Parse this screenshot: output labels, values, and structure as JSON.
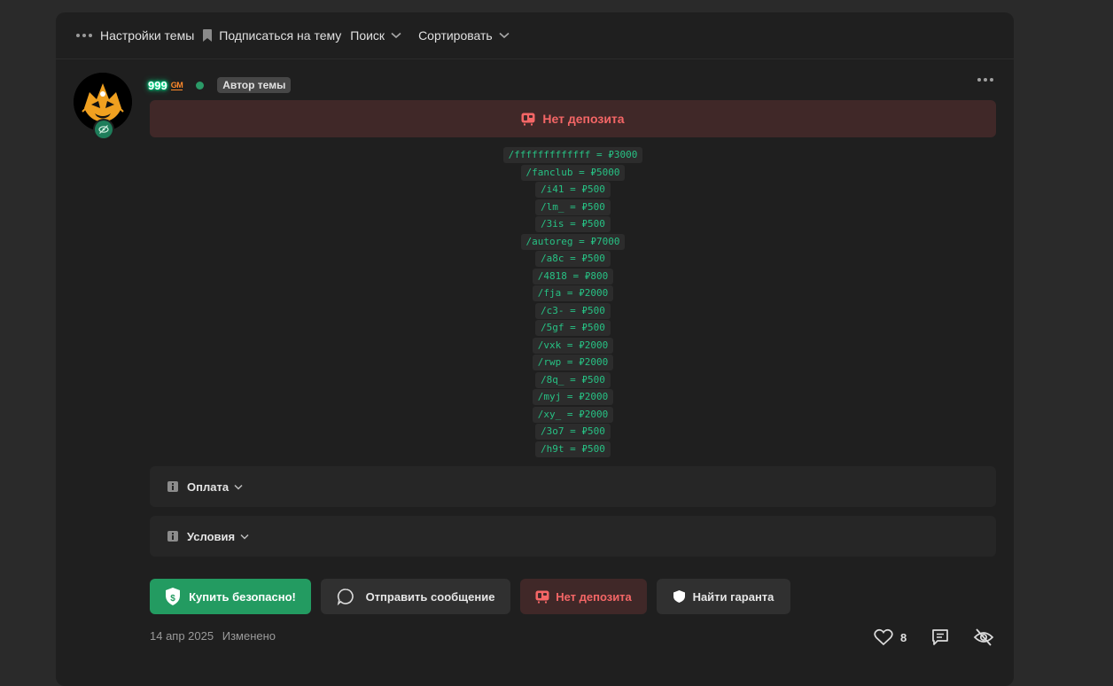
{
  "toolbar": {
    "settings_label": "Настройки темы",
    "subscribe_label": "Подписаться на тему",
    "search_label": "Поиск",
    "sort_label": "Сортировать"
  },
  "post": {
    "username": "999",
    "rank": "GM",
    "author_badge": "Автор темы",
    "deposit_banner": "Нет депозита",
    "codes": [
      "/fffffffffffff = ₽3000",
      "/fanclub = ₽5000",
      "/i41 = ₽500",
      "/lm_ = ₽500",
      "/3is = ₽500",
      "/autoreg = ₽7000",
      "/a8c = ₽500",
      "/4818 = ₽800",
      "/fja = ₽2000",
      "/c3- = ₽500",
      "/5gf = ₽500",
      "/vxk = ₽2000",
      "/rwp = ₽2000",
      "/8q_ = ₽500",
      "/myj = ₽2000",
      "/xy_ = ₽2000",
      "/3o7 = ₽500",
      "/h9t = ₽500"
    ],
    "spoilers": {
      "payment": "Оплата",
      "conditions": "Условия"
    },
    "buttons": {
      "buy": "Купить безопасно!",
      "message": "Отправить сообщение",
      "no_deposit": "Нет депозита",
      "guarantor": "Найти гаранта"
    },
    "date": "14 апр 2025",
    "edited": "Изменено",
    "likes": "8"
  },
  "colors": {
    "accent_green": "#239b61",
    "code_green": "#27c184",
    "danger_red": "#f46666",
    "danger_bg": "#402828"
  },
  "icons": [
    "dots-icon",
    "bookmark-icon",
    "chevron-down-icon",
    "info-icon",
    "wallet-icon",
    "shield-dollar-icon",
    "chat-bubble-icon",
    "shield-icon",
    "heart-icon",
    "comment-icon",
    "eye-off-icon"
  ]
}
